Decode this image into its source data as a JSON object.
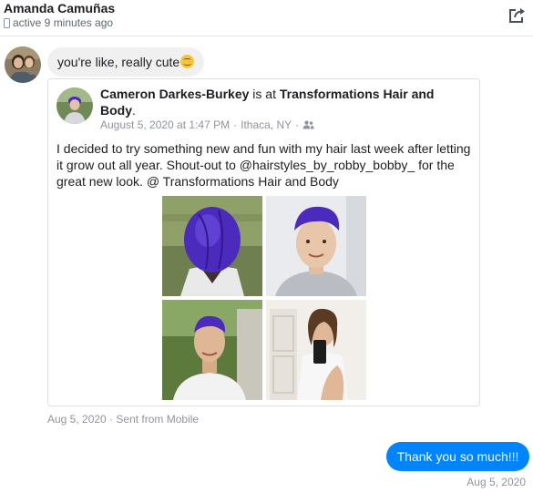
{
  "header": {
    "contact_name": "Amanda Camuñas",
    "status": "active 9 minutes ago",
    "icons": {
      "status": "phone-icon",
      "share": "share-icon"
    }
  },
  "conversation": {
    "incoming_message": "you're like, really cute",
    "incoming_emoji": "smiling-face-emoji",
    "shared_post": {
      "author": "Cameron Darkes-Burkey",
      "connector": " is at ",
      "place": "Transformations Hair and Body",
      "place_suffix": ".",
      "date": "August 5, 2020 at 1:47 PM",
      "separator": " · ",
      "location": "Ithaca, NY",
      "audience_icon": "friends-icon",
      "text": "I decided to try something new and fun with my hair last week after letting it grow out all year. Shout-out to @hairstyles_by_robby_bobby_ for the great new look. @ Transformations Hair and Body",
      "photo_count": 4
    },
    "sent_meta": "Aug 5, 2020 · Sent from Mobile",
    "outgoing_message": "Thank you so much!!!",
    "outgoing_time": "Aug 5, 2020"
  },
  "colors": {
    "accent": "#0084ff",
    "incoming_bubble": "#f1f0f0",
    "meta_text": "#90949c",
    "hair": "#4b2bbd"
  }
}
